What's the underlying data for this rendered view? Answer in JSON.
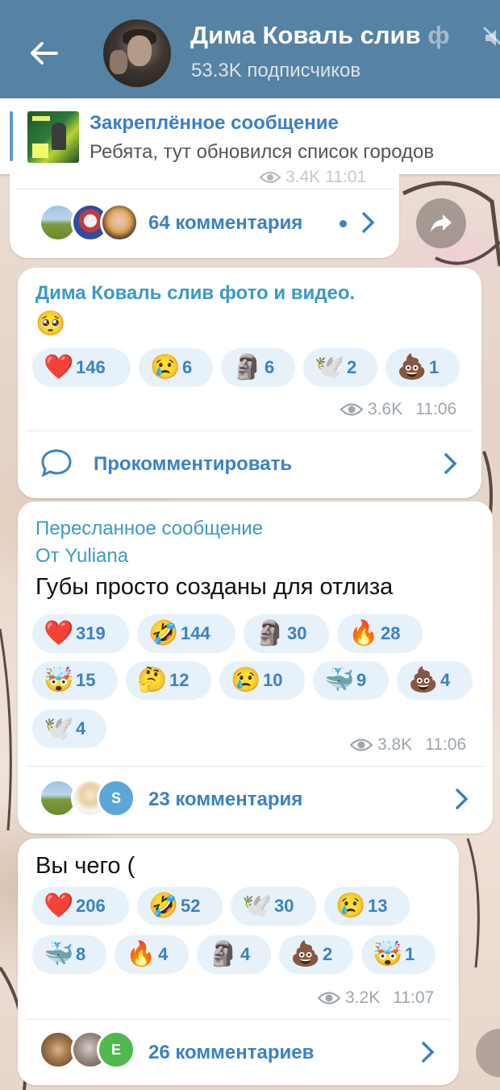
{
  "header": {
    "title": "Дима Коваль слив",
    "title_tail": "ф",
    "subscribers": "53.3K подписчиков"
  },
  "pinned": {
    "title": "Закреплённое сообщение",
    "text": "Ребята, тут обновился список городов"
  },
  "posts": [
    {
      "comments": "64 комментария",
      "views": "3.4K",
      "time": "11:01"
    },
    {
      "author": "Дима Коваль слив фото и видео.",
      "text": "🥺",
      "reactions": [
        {
          "emoji": "❤️",
          "count": "146"
        },
        {
          "emoji": "😢",
          "count": "6"
        },
        {
          "emoji": "🗿",
          "count": "6"
        },
        {
          "emoji": "🕊️",
          "count": "2"
        },
        {
          "emoji": "💩",
          "count": "1"
        }
      ],
      "views": "3.6K",
      "time": "11:06",
      "comment_action": "Прокомментировать"
    },
    {
      "forwarded_label": "Пересланное сообщение",
      "forwarded_from": "От Yuliana",
      "text": "Губы просто созданы для отлиза",
      "reactions": [
        {
          "emoji": "❤️",
          "count": "319"
        },
        {
          "emoji": "🤣",
          "count": "144"
        },
        {
          "emoji": "🗿",
          "count": "30"
        },
        {
          "emoji": "🔥",
          "count": "28"
        },
        {
          "emoji": "🤯",
          "count": "15"
        },
        {
          "emoji": "🤔",
          "count": "12"
        },
        {
          "emoji": "😢",
          "count": "10"
        },
        {
          "emoji": "🐳",
          "count": "9"
        },
        {
          "emoji": "💩",
          "count": "4"
        },
        {
          "emoji": "🕊️",
          "count": "4"
        }
      ],
      "views": "3.8K",
      "time": "11:06",
      "comments": "23 комментария",
      "commenter_initial": "S"
    },
    {
      "text": "Вы чего (",
      "reactions": [
        {
          "emoji": "❤️",
          "count": "206"
        },
        {
          "emoji": "🤣",
          "count": "52"
        },
        {
          "emoji": "🕊️",
          "count": "30"
        },
        {
          "emoji": "😢",
          "count": "13"
        },
        {
          "emoji": "🐳",
          "count": "8"
        },
        {
          "emoji": "🔥",
          "count": "4"
        },
        {
          "emoji": "🗿",
          "count": "4"
        },
        {
          "emoji": "💩",
          "count": "2"
        },
        {
          "emoji": "🤯",
          "count": "1"
        }
      ],
      "views": "3.2K",
      "time": "11:07",
      "comments": "26 комментариев",
      "commenter_initial": "E"
    }
  ],
  "colors": {
    "header_bg": "#5682a3",
    "accent": "#3a82c4",
    "reaction_bg": "#e6f1fa"
  }
}
